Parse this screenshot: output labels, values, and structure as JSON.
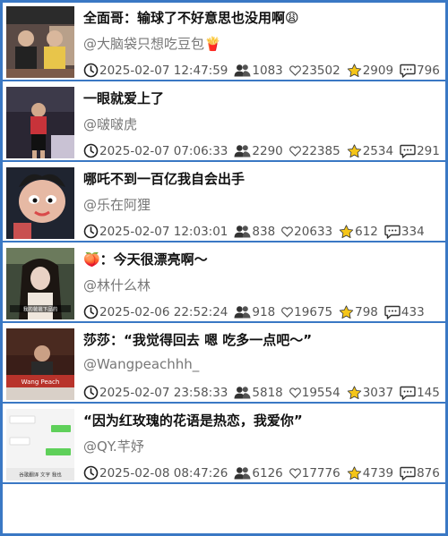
{
  "videos": [
    {
      "title": "全面哥：输球了不好意思也没用啊😩",
      "author": "@大脑袋只想吃豆包🍟",
      "time": "2025-02-07 12:47:59",
      "viewers": "1083",
      "likes": "23502",
      "favorites": "2909",
      "comments": "796",
      "thumb": {
        "bg": "#5a4a45",
        "accent": "#e8c54a",
        "icon": "studio-scene-thumbnail",
        "caption": ""
      }
    },
    {
      "title": "一眼就爱上了",
      "author": "@啵啵虎",
      "time": "2025-02-07 07:06:33",
      "viewers": "2290",
      "likes": "22385",
      "favorites": "2534",
      "comments": "291",
      "thumb": {
        "bg": "#2a2633",
        "accent": "#c8333a",
        "icon": "person-thumbnail",
        "caption": ""
      }
    },
    {
      "title": "哪吒不到一百亿我自会出手",
      "author": "@乐在阿狸",
      "time": "2025-02-07 12:03:01",
      "viewers": "838",
      "likes": "20633",
      "favorites": "612",
      "comments": "334",
      "thumb": {
        "bg": "#1f2430",
        "accent": "#d94a4a",
        "icon": "cartoon-character-thumbnail",
        "caption": ""
      }
    },
    {
      "title": "🍑：今天很漂亮啊～",
      "author": "@林什么林",
      "time": "2025-02-06 22:52:24",
      "viewers": "918",
      "likes": "19675",
      "favorites": "798",
      "comments": "433",
      "thumb": {
        "bg": "#3f4a3a",
        "accent": "#e9d2c5",
        "icon": "portrait-thumbnail",
        "caption": "我的爸爸下品的"
      }
    },
    {
      "title": "莎莎：“我觉得回去 嗯 吃多一点吧～”",
      "author": "@Wangpeachhh_",
      "time": "2025-02-07 23:58:33",
      "viewers": "5818",
      "likes": "19554",
      "favorites": "3037",
      "comments": "145",
      "thumb": {
        "bg": "#3a1e18",
        "accent": "#b8332b",
        "icon": "dinner-scene-thumbnail",
        "caption": "Wang Peach"
      }
    },
    {
      "title": "“因为红玫瑰的花语是热恋，我爱你”",
      "author": "@QY.芊妤",
      "time": "2025-02-08 08:47:26",
      "viewers": "6126",
      "likes": "17776",
      "favorites": "4739",
      "comments": "876",
      "thumb": {
        "bg": "#f4f4f4",
        "accent": "#5fd05a",
        "icon": "chat-screenshot-thumbnail",
        "caption": "谷歌翻译 文字 我也"
      }
    }
  ]
}
